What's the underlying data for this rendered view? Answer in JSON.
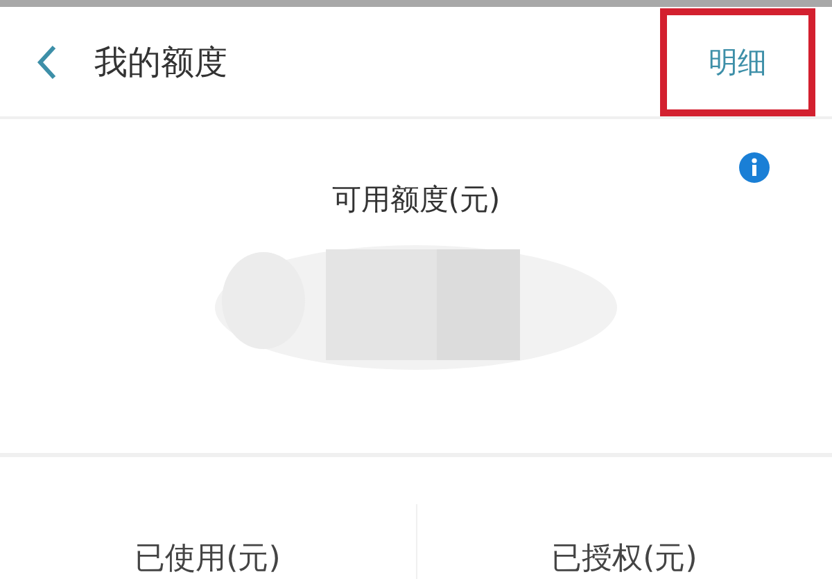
{
  "header": {
    "title": "我的额度",
    "action": {
      "label": "明细",
      "highlighted": true
    }
  },
  "available": {
    "label": "可用额度(元)",
    "amount_hidden": true
  },
  "stats": [
    {
      "label": "已使用(元)"
    },
    {
      "label": "已授权(元)"
    }
  ]
}
